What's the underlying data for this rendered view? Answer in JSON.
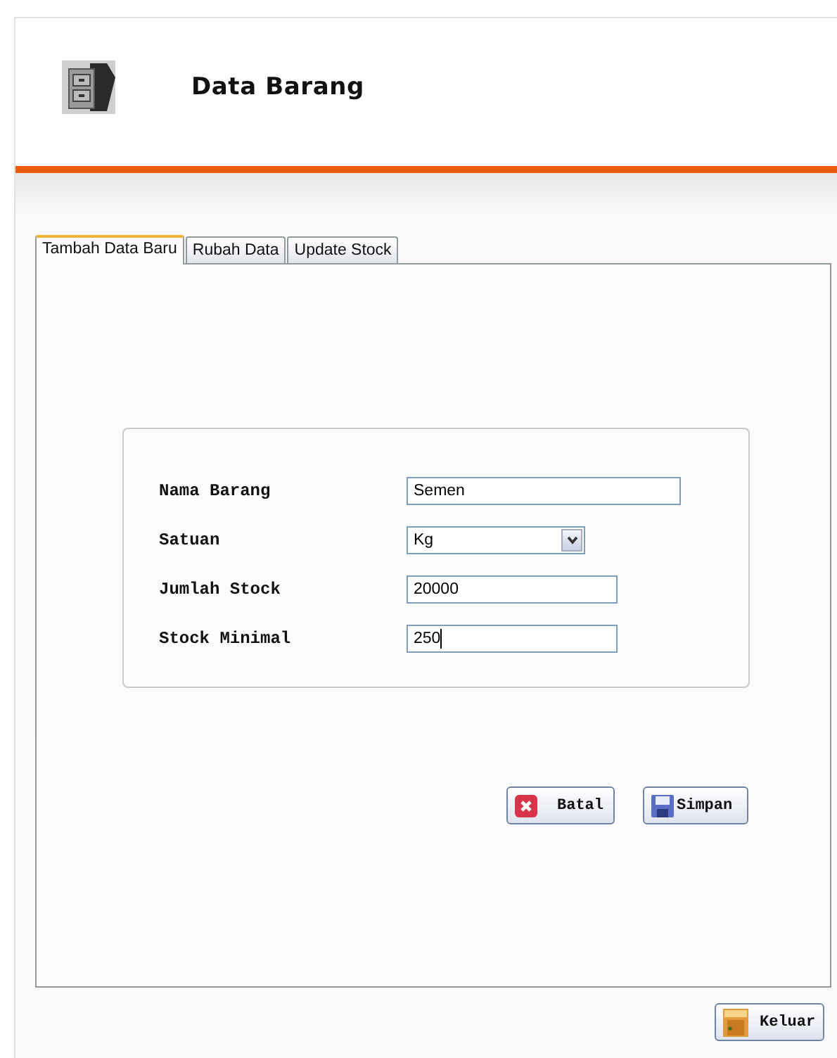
{
  "window": {
    "title": "Data Barang"
  },
  "tabs": [
    {
      "label": "Tambah Data Baru",
      "selected": true
    },
    {
      "label": "Rubah Data",
      "selected": false
    },
    {
      "label": "Update Stock",
      "selected": false
    }
  ],
  "form": {
    "fields": [
      {
        "label": "Nama Barang",
        "kind": "text",
        "value": "Semen",
        "focused": false
      },
      {
        "label": "Satuan",
        "kind": "select",
        "value": "Kg",
        "focused": false
      },
      {
        "label": "Jumlah Stock",
        "kind": "text",
        "value": "20000",
        "focused": false
      },
      {
        "label": "Stock Minimal",
        "kind": "text",
        "value": "250",
        "focused": true
      }
    ]
  },
  "buttons": [
    {
      "label": "Batal",
      "kind": "cancel"
    },
    {
      "label": "Simpan",
      "kind": "save"
    }
  ],
  "exit_button": {
    "label": "Keluar"
  }
}
